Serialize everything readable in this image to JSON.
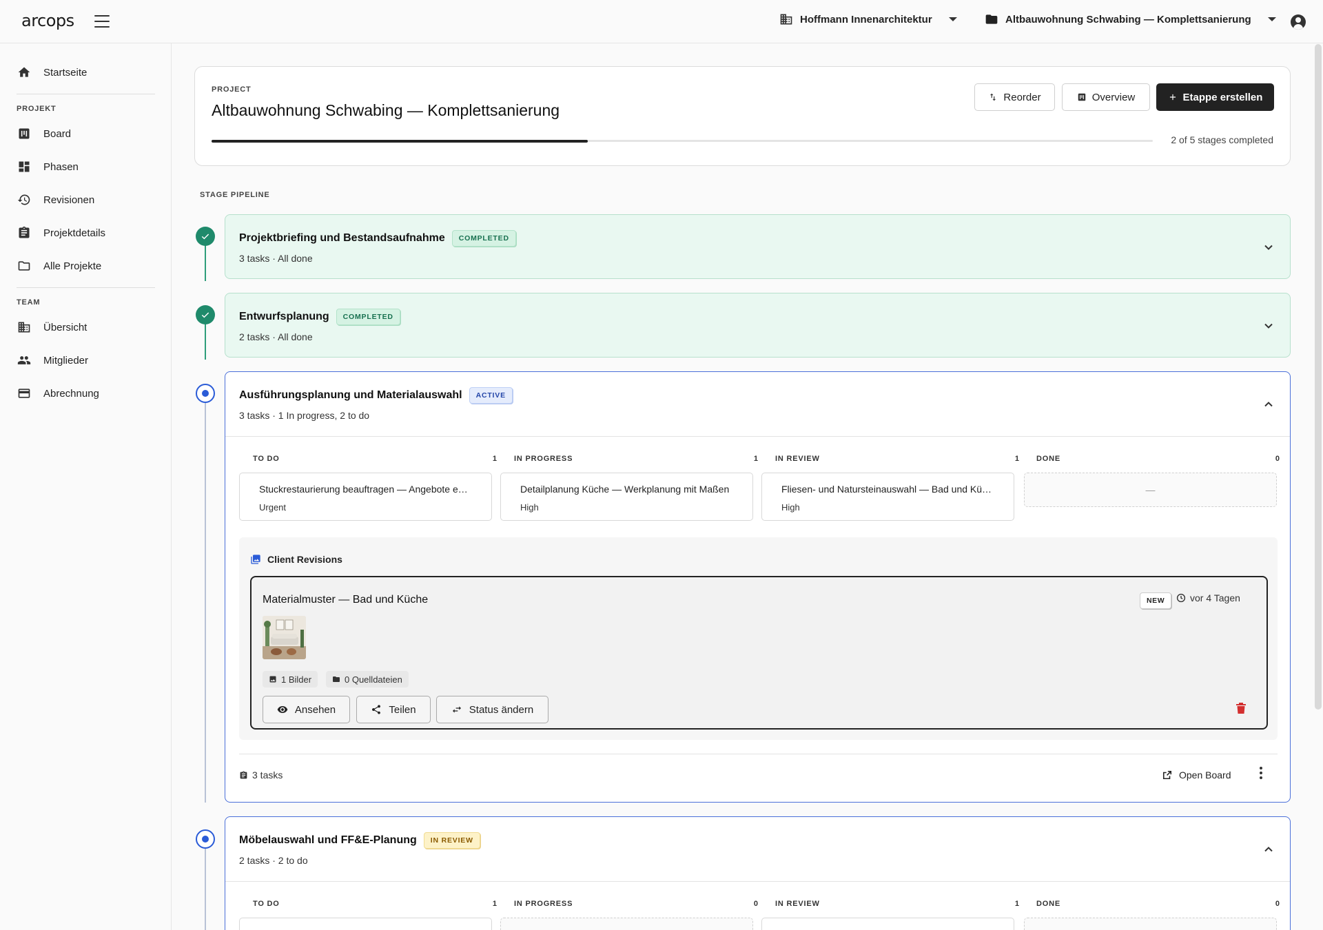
{
  "app": {
    "logo": "arcops"
  },
  "topbar": {
    "org": "Hoffmann Innenarchitektur",
    "project": "Altbauwohnung Schwabing — Komplettsanierung"
  },
  "sidebar": {
    "home": "Startseite",
    "section_project": "PROJEKT",
    "project_items": [
      "Board",
      "Phasen",
      "Revisionen",
      "Projektdetails",
      "Alle Projekte"
    ],
    "section_team": "TEAM",
    "team_items": [
      "Übersicht",
      "Mitglieder",
      "Abrechnung"
    ]
  },
  "project": {
    "label": "PROJECT",
    "title": "Altbauwohnung Schwabing — Komplettsanierung",
    "buttons": {
      "reorder": "Reorder",
      "overview": "Overview",
      "create": "Etappe erstellen"
    },
    "progress_fraction": 0.4,
    "progress_text": "2 of 5 stages completed"
  },
  "pipeline": {
    "label": "STAGE PIPELINE",
    "stages": [
      {
        "title": "Projektbriefing und Bestandsaufnahme",
        "badge": "COMPLETED",
        "sub": "3 tasks · All done"
      },
      {
        "title": "Entwurfsplanung",
        "badge": "COMPLETED",
        "sub": "2 tasks · All done"
      },
      {
        "title": "Ausführungsplanung und Materialauswahl",
        "badge": "ACTIVE",
        "sub": "3 tasks · 1 In progress, 2 to do",
        "columns": [
          {
            "name": "TO DO",
            "count": "1"
          },
          {
            "name": "IN PROGRESS",
            "count": "1"
          },
          {
            "name": "IN REVIEW",
            "count": "1"
          },
          {
            "name": "DONE",
            "count": "0"
          }
        ],
        "tasks": [
          {
            "title": "Stuckrestaurierung beauftragen — Angebote e…",
            "priority": "Urgent"
          },
          {
            "title": "Detailplanung Küche — Werkplanung mit Maßen",
            "priority": "High"
          },
          {
            "title": "Fliesen- und Natursteinauswahl — Bad und Kü…",
            "priority": "High"
          }
        ],
        "empty_placeholder": "—",
        "revisions": {
          "heading": "Client Revisions",
          "card": {
            "title": "Materialmuster — Bad und Küche",
            "badge": "NEW",
            "time": "vor 4 Tagen",
            "images": "1 Bilder",
            "sources": "0 Quelldateien",
            "view": "Ansehen",
            "share": "Teilen",
            "status": "Status ändern"
          }
        },
        "footer": {
          "tasks": "3 tasks",
          "open_board": "Open Board"
        }
      },
      {
        "title": "Möbelauswahl und FF&E-Planung",
        "badge": "IN REVIEW",
        "sub": "2 tasks · 2 to do",
        "columns": [
          {
            "name": "TO DO",
            "count": "1"
          },
          {
            "name": "IN PROGRESS",
            "count": "0"
          },
          {
            "name": "IN REVIEW",
            "count": "1"
          },
          {
            "name": "DONE",
            "count": "0"
          }
        ]
      }
    ]
  },
  "colors": {
    "accent": "#2a5bd7",
    "success": "#1f8a6b",
    "danger": "#d32f2f",
    "dark": "#222222"
  }
}
